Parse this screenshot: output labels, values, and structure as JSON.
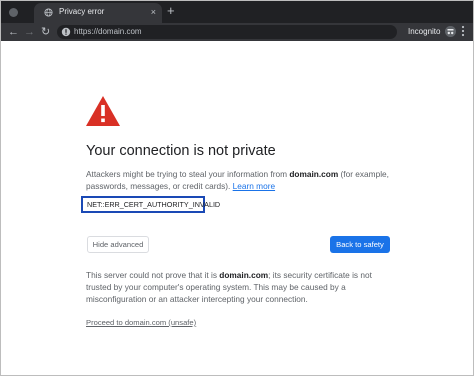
{
  "titlebar": {
    "tab_title": "Privacy error",
    "tab_close_icon": "×",
    "new_tab_icon": "+"
  },
  "toolbar": {
    "back_icon": "←",
    "forward_icon": "→",
    "reload_icon": "↻",
    "url": "https://domain.com",
    "profile_label": "Incognito",
    "menu_icon": "⋮"
  },
  "interstitial": {
    "heading": "Your connection is not private",
    "description_before": "Attackers might be trying to steal your information from ",
    "description_domain": "domain.com",
    "description_after": " (for example, passwords, messages, or credit cards). ",
    "learn_more": "Learn more",
    "error_code": "NET::ERR_CERT_AUTHORITY_INVALID",
    "hide_advanced_label": "Hide advanced",
    "back_to_safety_label": "Back to safety",
    "advanced_before": "This server could not prove that it is ",
    "advanced_domain": "domain.com",
    "advanced_after": "; its security certificate is not trusted by your computer's operating system. This may be caused by a misconfiguration or an attacker intercepting your connection.",
    "proceed_link": "Proceed to domain.com (unsafe)"
  },
  "colors": {
    "accent": "#1a73e8",
    "warning": "#d93025",
    "highlight_box": "#1a49b5"
  }
}
